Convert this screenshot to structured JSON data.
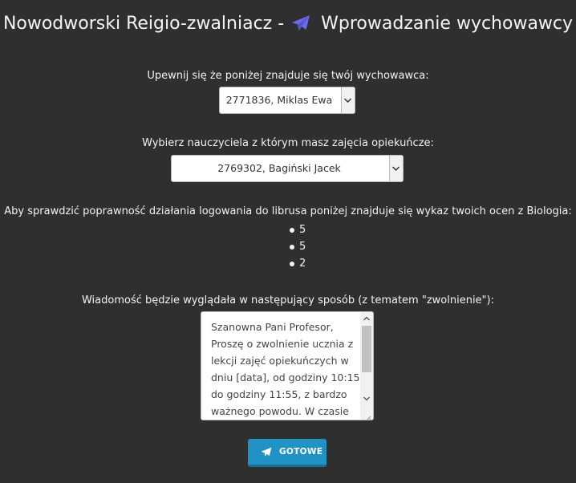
{
  "header": {
    "title_left": "Nowodworski Reigio-zwalniacz -",
    "icon": "paper-plane-icon",
    "title_right": "Wprowadzanie wychowawcy",
    "icon_color": "#6b6be8"
  },
  "form": {
    "homeroom_label": "Upewnij się że poniżej znajduje się twój wychowawca:",
    "homeroom_value": "2771836, Miklas Ewa",
    "teacher_label": "Wybierz nauczyciela z którym masz zajęcia opiekuńcze:",
    "teacher_value": "2769302, Bagiński Jacek",
    "grades_label": "Aby sprawdzić poprawność działania logowania do librusa poniżej znajduje się wykaz twoich ocen z Biologia:",
    "grades": [
      "5",
      "5",
      "2"
    ],
    "message_label": "Wiadomość będzie wyglądała w następujący sposób (z tematem \"zwolnienie\"):",
    "message_text": "Szanowna Pani Profesor,\nProszę o zwolnienie ucznia z lekcji zajęć opiekuńczych w dniu [data], od godziny 10:15 do godziny 11:55, z bardzo ważnego powodu. W czasie",
    "submit_label": "GOTOWE",
    "submit_icon": "paper-plane-icon",
    "button_color": "#2192c4"
  }
}
